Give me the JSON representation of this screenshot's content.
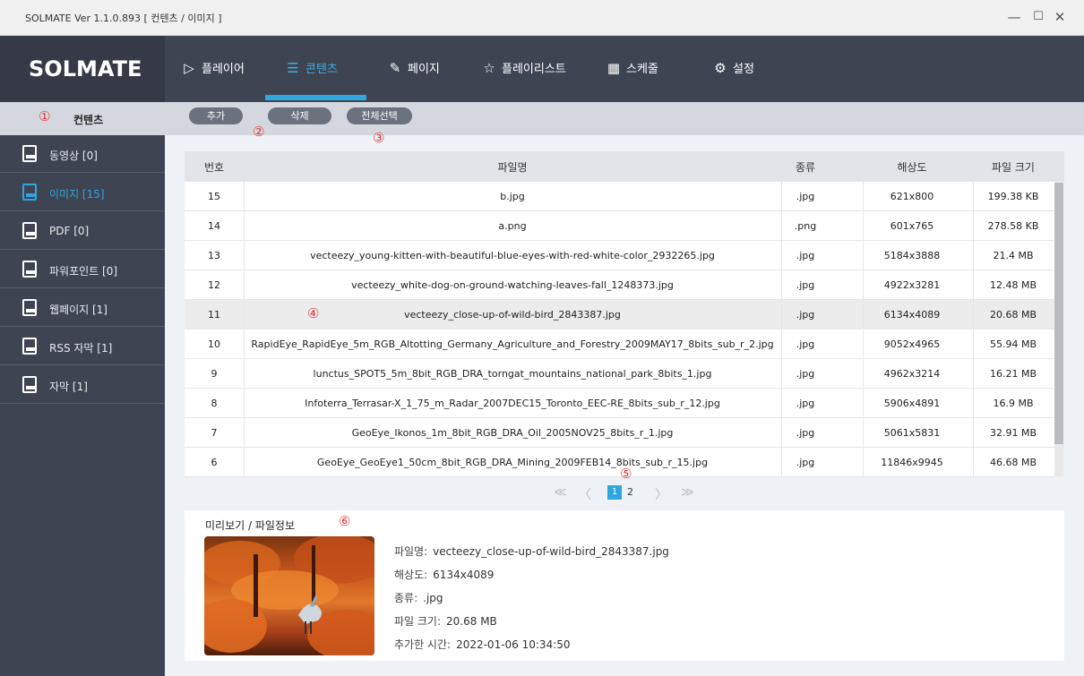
{
  "window": {
    "title": "SOLMATE Ver 1.1.0.893  [ 컨텐츠 / 이미지 ]"
  },
  "brand": {
    "logo": "SOLMATE"
  },
  "nav": [
    {
      "label": "플레이어",
      "icon": "play-icon"
    },
    {
      "label": "콘텐츠",
      "icon": "list-icon",
      "active": true
    },
    {
      "label": "페이지",
      "icon": "pin-icon"
    },
    {
      "label": "플레이리스트",
      "icon": "star-icon"
    },
    {
      "label": "스케줄",
      "icon": "calendar-icon"
    },
    {
      "label": "설정",
      "icon": "gear-icon"
    }
  ],
  "sidebar": {
    "header": {
      "marker": "①",
      "label": "컨텐츠"
    },
    "items": [
      {
        "label": "동영상 [0]",
        "icon": "video-file-icon"
      },
      {
        "label": "이미지 [15]",
        "icon": "image-file-icon",
        "active": true
      },
      {
        "label": "PDF [0]",
        "icon": "pdf-file-icon"
      },
      {
        "label": "파워포인트 [0]",
        "icon": "ppt-file-icon"
      },
      {
        "label": "웹페이지 [1]",
        "icon": "html-file-icon"
      },
      {
        "label": "RSS 자막 [1]",
        "icon": "rss-file-icon"
      },
      {
        "label": "자막 [1]",
        "icon": "subtitle-file-icon"
      }
    ]
  },
  "toolbar": {
    "add": "추가",
    "delete": "삭제",
    "select_all": "전체선택"
  },
  "annotations": {
    "a2": "②",
    "a3": "③",
    "a4": "④",
    "a5": "⑤",
    "a6": "⑥"
  },
  "table": {
    "headers": [
      "번호",
      "파일명",
      "종류",
      "해상도",
      "파일 크기"
    ],
    "rows": [
      [
        "15",
        "b.jpg",
        ".jpg",
        "621x800",
        "199.38 KB"
      ],
      [
        "14",
        "a.png",
        ".png",
        "601x765",
        "278.58 KB"
      ],
      [
        "13",
        "vecteezy_young-kitten-with-beautiful-blue-eyes-with-red-white-color_2932265.jpg",
        ".jpg",
        "5184x3888",
        "21.4 MB"
      ],
      [
        "12",
        "vecteezy_white-dog-on-ground-watching-leaves-fall_1248373.jpg",
        ".jpg",
        "4922x3281",
        "12.48 MB"
      ],
      [
        "11",
        "vecteezy_close-up-of-wild-bird_2843387.jpg",
        ".jpg",
        "6134x4089",
        "20.68 MB"
      ],
      [
        "10",
        "RapidEye_RapidEye_5m_RGB_Altotting_Germany_Agriculture_and_Forestry_2009MAY17_8bits_sub_r_2.jpg",
        ".jpg",
        "9052x4965",
        "55.94 MB"
      ],
      [
        "9",
        "lunctus_SPOT5_5m_8bit_RGB_DRA_torngat_mountains_national_park_8bits_1.jpg",
        ".jpg",
        "4962x3214",
        "16.21 MB"
      ],
      [
        "8",
        "Infoterra_Terrasar-X_1_75_m_Radar_2007DEC15_Toronto_EEC-RE_8bits_sub_r_12.jpg",
        ".jpg",
        "5906x4891",
        "16.9 MB"
      ],
      [
        "7",
        "GeoEye_Ikonos_1m_8bit_RGB_DRA_Oil_2005NOV25_8bits_r_1.jpg",
        ".jpg",
        "5061x5831",
        "32.91 MB"
      ],
      [
        "6",
        "GeoEye_GeoEye1_50cm_8bit_RGB_DRA_Mining_2009FEB14_8bits_sub_r_15.jpg",
        ".jpg",
        "11846x9945",
        "46.68 MB"
      ]
    ]
  },
  "pagination": {
    "first": "≪",
    "prev": "〈",
    "current": "1",
    "next_page": "2",
    "next": "〉",
    "last": "≫"
  },
  "preview": {
    "title": "미리보기 / 파일정보",
    "filename_label": "파일명:",
    "filename": "vecteezy_close-up-of-wild-bird_2843387.jpg",
    "resolution_label": "해상도:",
    "resolution": "6134x4089",
    "type_label": "종류:",
    "type": ".jpg",
    "size_label": "파일 크기:",
    "size": "20.68 MB",
    "added_label": "추가한 시간:",
    "added": "2022-01-06 10:34:50"
  },
  "colors": {
    "accent": "#2fa6e0",
    "nav_bg": "#3e4452",
    "annotation": "#e03a3a"
  }
}
